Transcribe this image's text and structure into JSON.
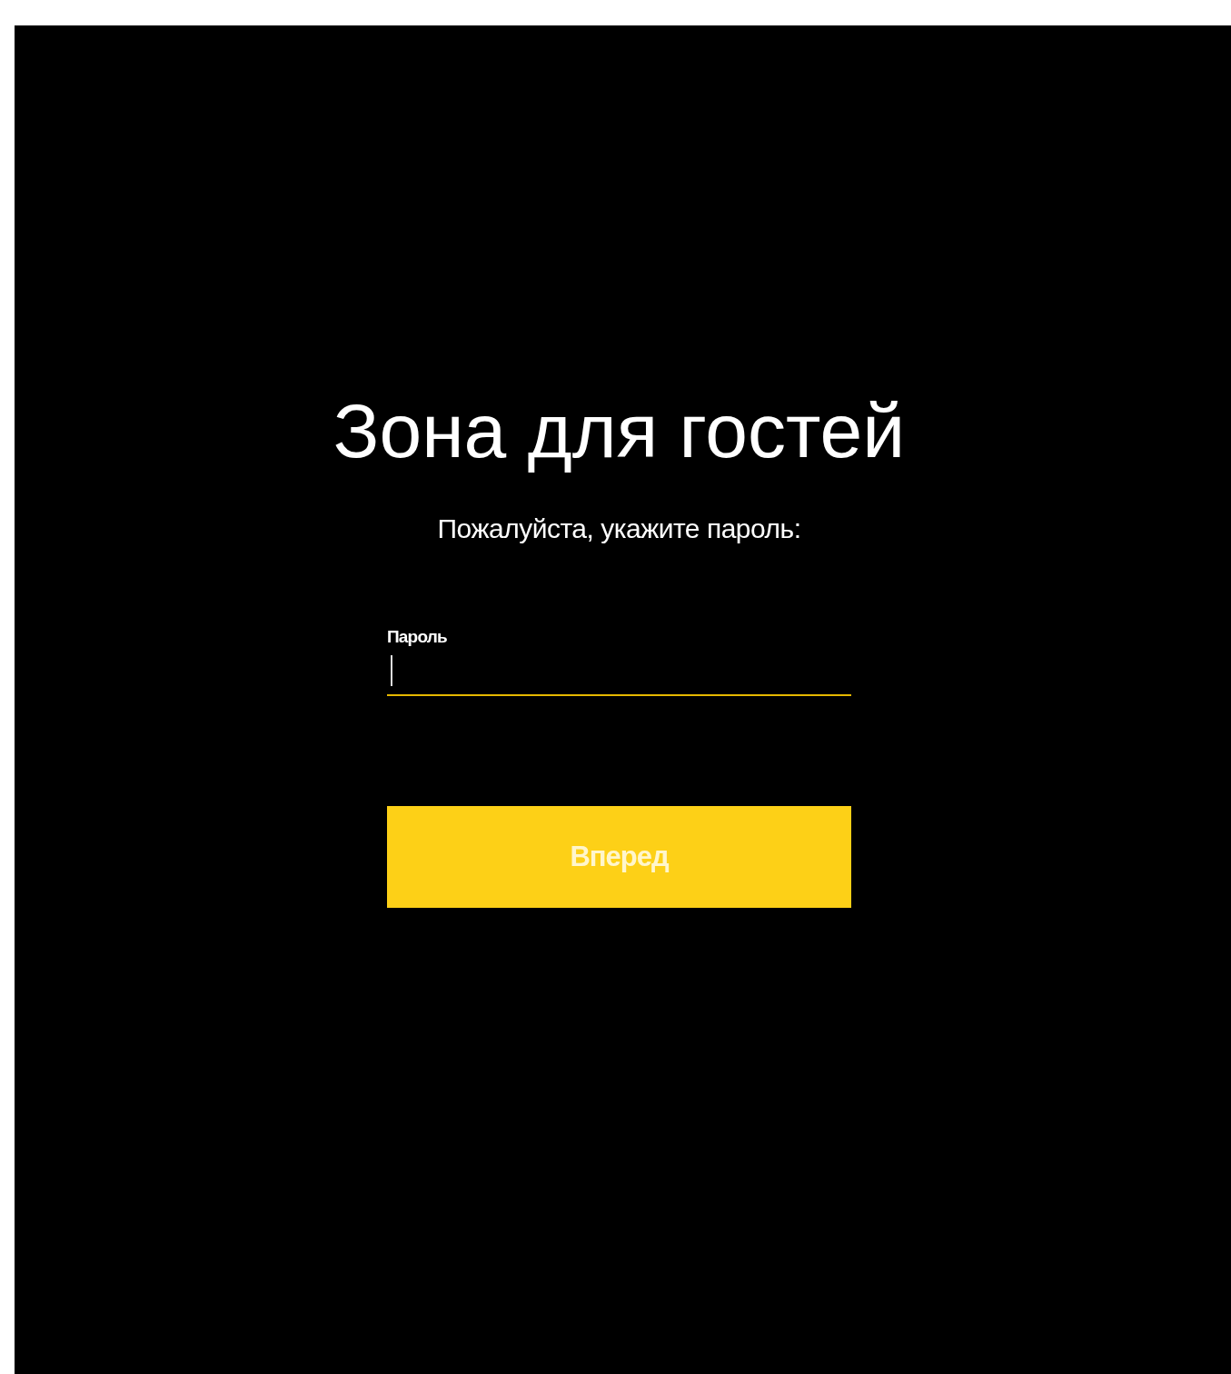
{
  "title": "Зона для гостей",
  "prompt": "Пожалуйста, укажите пароль:",
  "password_field": {
    "label": "Пароль",
    "focused": true
  },
  "submit_button": {
    "label": "Вперед"
  }
}
